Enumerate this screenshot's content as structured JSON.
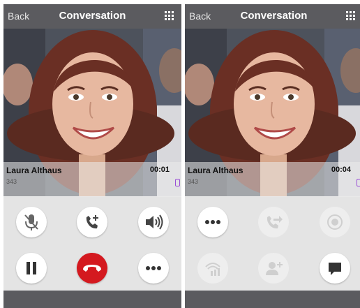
{
  "colors": {
    "nav_bar": "#5b5b5f",
    "controls_bg": "#e4e4e4",
    "end_call": "#d4191f",
    "device_indicator": "#9a4fd6"
  },
  "screens": [
    {
      "nav": {
        "back_label": "Back",
        "title": "Conversation",
        "grid_icon": "dialpad-grid-icon"
      },
      "caller": {
        "name": "Laura Althaus",
        "extension": "343",
        "duration": "00:01",
        "device_icon": "mobile-device-icon"
      },
      "controls": [
        {
          "name": "mute",
          "icon": "mic-mute-icon",
          "enabled": true
        },
        {
          "name": "add-call",
          "icon": "add-call-icon",
          "enabled": true
        },
        {
          "name": "speaker",
          "icon": "speaker-icon",
          "enabled": true
        },
        {
          "name": "hold",
          "icon": "pause-icon",
          "enabled": true
        },
        {
          "name": "end-call",
          "icon": "hangup-icon",
          "enabled": true
        },
        {
          "name": "more",
          "icon": "more-dots-icon",
          "enabled": true
        }
      ]
    },
    {
      "nav": {
        "back_label": "Back",
        "title": "Conversation",
        "grid_icon": "dialpad-grid-icon"
      },
      "caller": {
        "name": "Laura Althaus",
        "extension": "343",
        "duration": "00:04",
        "device_icon": "mobile-device-icon"
      },
      "controls": [
        {
          "name": "more",
          "icon": "more-dots-icon",
          "enabled": true
        },
        {
          "name": "transfer",
          "icon": "transfer-icon",
          "enabled": false
        },
        {
          "name": "record",
          "icon": "record-icon",
          "enabled": false
        },
        {
          "name": "handover",
          "icon": "handover-icon",
          "enabled": false
        },
        {
          "name": "add-participant",
          "icon": "add-participant-icon",
          "enabled": false
        },
        {
          "name": "chat",
          "icon": "chat-icon",
          "enabled": true
        }
      ]
    }
  ]
}
